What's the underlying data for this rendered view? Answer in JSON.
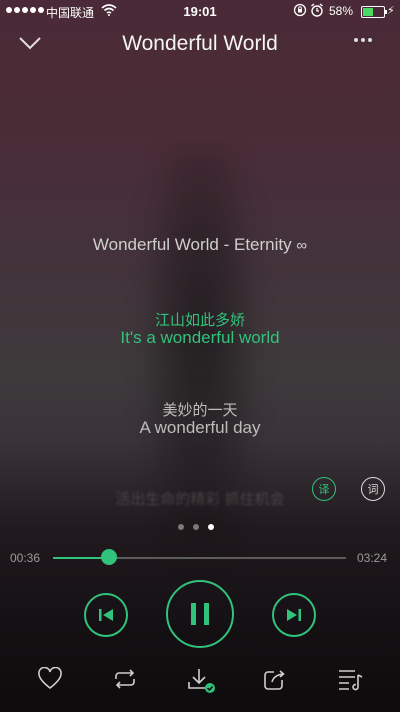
{
  "status_bar": {
    "carrier": "中国联通",
    "time": "19:01",
    "battery_percent": "58%",
    "battery_level": 0.58,
    "signal_bars": 5
  },
  "header": {
    "title": "Wonderful World",
    "back_icon": "chevron-down-icon",
    "more_icon": "more-dots-icon"
  },
  "lyrics": {
    "song_line": "Wonderful World - Eternity",
    "quality_icon": "infinity-icon",
    "lines": [
      {
        "zh": "江山如此多娇",
        "en": "It's a wonderful world",
        "active": true
      },
      {
        "zh": "美妙的一天",
        "en": "A wonderful day",
        "active": false
      }
    ],
    "faded_line": "活出生命的精彩 抓住机会",
    "translate_label": "译",
    "search_lyrics_label": "词"
  },
  "pager": {
    "count": 3,
    "active_index": 2
  },
  "progress": {
    "current": "00:36",
    "total": "03:24",
    "fraction": 0.19
  },
  "controls": {
    "prev_icon": "previous-track-icon",
    "play_pause_icon": "pause-icon",
    "next_icon": "next-track-icon",
    "accent": "#31c27c"
  },
  "bottom_bar": {
    "icons": [
      "heart-icon",
      "repeat-icon",
      "download-icon",
      "share-icon",
      "playlist-icon"
    ]
  }
}
